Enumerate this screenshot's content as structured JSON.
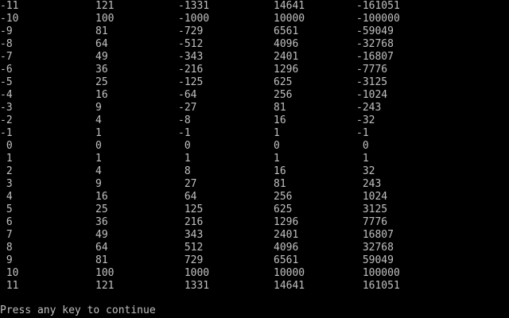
{
  "console": {
    "rows": [
      [
        "-11",
        "121",
        "-1331",
        "14641",
        "-161051"
      ],
      [
        "-10",
        "100",
        "-1000",
        "10000",
        "-100000"
      ],
      [
        "-9",
        "81",
        "-729",
        "6561",
        "-59049"
      ],
      [
        "-8",
        "64",
        "-512",
        "4096",
        "-32768"
      ],
      [
        "-7",
        "49",
        "-343",
        "2401",
        "-16807"
      ],
      [
        "-6",
        "36",
        "-216",
        "1296",
        "-7776"
      ],
      [
        "-5",
        "25",
        "-125",
        "625",
        "-3125"
      ],
      [
        "-4",
        "16",
        "-64",
        "256",
        "-1024"
      ],
      [
        "-3",
        "9",
        "-27",
        "81",
        "-243"
      ],
      [
        "-2",
        "4",
        "-8",
        "16",
        "-32"
      ],
      [
        "-1",
        "1",
        "-1",
        "1",
        "-1"
      ],
      [
        " 0",
        "0",
        " 0",
        "0",
        " 0"
      ],
      [
        " 1",
        "1",
        " 1",
        "1",
        " 1"
      ],
      [
        " 2",
        "4",
        " 8",
        "16",
        " 32"
      ],
      [
        " 3",
        "9",
        " 27",
        "81",
        " 243"
      ],
      [
        " 4",
        "16",
        " 64",
        "256",
        " 1024"
      ],
      [
        " 5",
        "25",
        " 125",
        "625",
        " 3125"
      ],
      [
        " 6",
        "36",
        " 216",
        "1296",
        " 7776"
      ],
      [
        " 7",
        "49",
        " 343",
        "2401",
        " 16807"
      ],
      [
        " 8",
        "64",
        " 512",
        "4096",
        " 32768"
      ],
      [
        " 9",
        "81",
        " 729",
        "6561",
        " 59049"
      ],
      [
        " 10",
        "100",
        " 1000",
        "10000",
        " 100000"
      ],
      [
        " 11",
        "121",
        " 1331",
        "14641",
        " 161051"
      ]
    ],
    "prompt": "Press any key to continue",
    "colors": {
      "background": "#000000",
      "text": "#c0c0c0"
    }
  }
}
